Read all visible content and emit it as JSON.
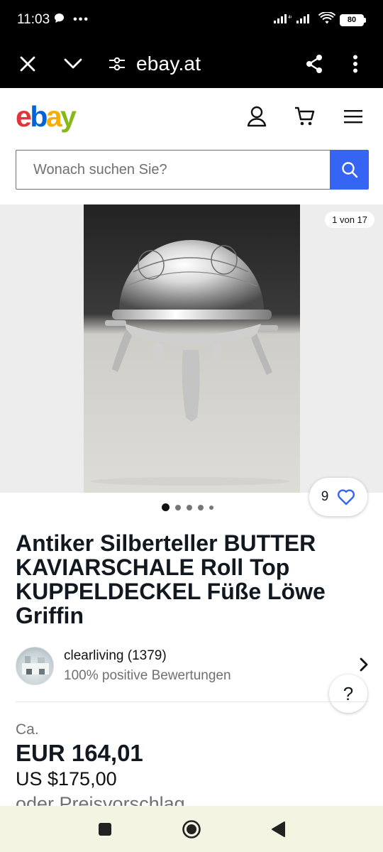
{
  "status_bar": {
    "time": "11:03",
    "battery": "80"
  },
  "browser": {
    "url": "ebay.at"
  },
  "header": {
    "logo_letters": [
      "e",
      "b",
      "a",
      "y"
    ],
    "logo_colors": [
      "#e53238",
      "#0064d2",
      "#f5af02",
      "#86b817"
    ]
  },
  "search": {
    "placeholder": "Wonach suchen Sie?",
    "value": ""
  },
  "gallery": {
    "counter": "1 von 17",
    "watchers": "9"
  },
  "listing": {
    "title": "Antiker Silberteller BUTTER KAVIARSCHALE Roll Top KUPPELDECKEL Füße Löwe Griffin",
    "seller_name": "clearliving (1379)",
    "seller_rating": "100% positive Bewertungen",
    "help": "?",
    "approx_label": "Ca.",
    "price": "EUR 164,01",
    "price_usd": "US $175,00",
    "offer_label": "oder Preisvorschlag"
  },
  "colors": {
    "accent": "#3665f3",
    "text": "#111820",
    "muted": "#707070"
  }
}
